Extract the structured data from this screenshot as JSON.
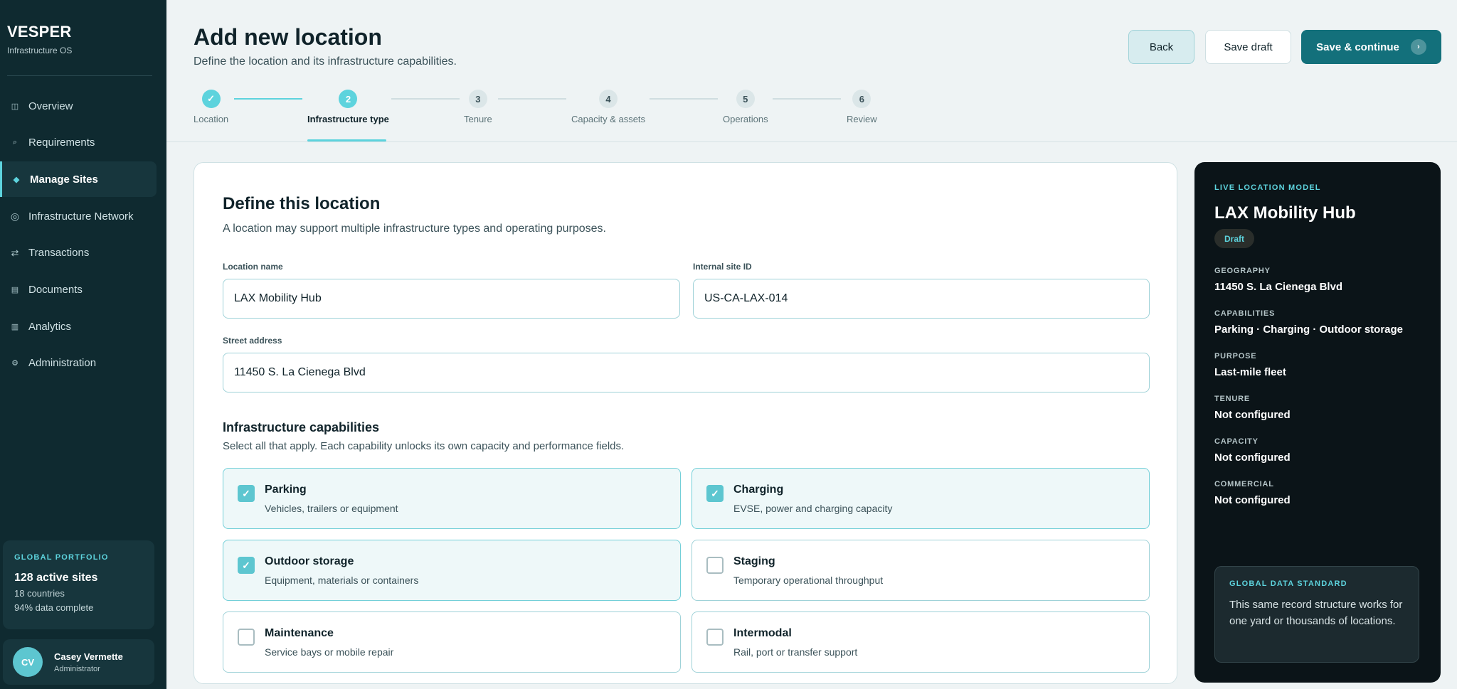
{
  "brand": {
    "name": "VESPER",
    "tagline": "Infrastructure OS"
  },
  "sidebar": {
    "items": [
      {
        "label": "Overview",
        "icon": "grid-icon"
      },
      {
        "label": "Requirements",
        "icon": "search-icon"
      },
      {
        "label": "Manage Sites",
        "icon": "diamond-icon",
        "active": true
      },
      {
        "label": "Infrastructure Network",
        "icon": "ring-icon"
      },
      {
        "label": "Transactions",
        "icon": "arrows-icon"
      },
      {
        "label": "Documents",
        "icon": "document-icon"
      },
      {
        "label": "Analytics",
        "icon": "bar-icon"
      },
      {
        "label": "Administration",
        "icon": "gear-icon"
      }
    ],
    "portfolio": {
      "eyebrow": "GLOBAL PORTFOLIO",
      "headline": "128 active sites",
      "countries": "18 countries",
      "completeness": "94% data complete"
    },
    "user": {
      "initials": "CV",
      "name": "Casey Vermette",
      "role": "Administrator"
    }
  },
  "header": {
    "title": "Add new location",
    "subtitle": "Define the location and its infrastructure capabilities.",
    "back_label": "Back",
    "draft_label": "Save draft",
    "save_label": "Save & continue"
  },
  "stepper": {
    "steps": [
      {
        "number": "1",
        "label": "Location",
        "state": "done"
      },
      {
        "number": "2",
        "label": "Infrastructure type",
        "state": "current"
      },
      {
        "number": "3",
        "label": "Tenure",
        "state": "todo"
      },
      {
        "number": "4",
        "label": "Capacity & assets",
        "state": "todo"
      },
      {
        "number": "5",
        "label": "Operations",
        "state": "todo"
      },
      {
        "number": "6",
        "label": "Review",
        "state": "todo"
      }
    ]
  },
  "form": {
    "title": "Define this location",
    "subtitle": "A location may support multiple infrastructure types and operating purposes.",
    "location_name_label": "Location name",
    "location_name_value": "LAX Mobility Hub",
    "site_id_label": "Internal site ID",
    "site_id_value": "US-CA-LAX-014",
    "street_label": "Street address",
    "street_value": "11450 S. La Cienega Blvd",
    "capabilities_title": "Infrastructure capabilities",
    "capabilities_subtitle": "Select all that apply. Each capability unlocks its own capacity and performance fields.",
    "capabilities": [
      {
        "name": "Parking",
        "desc": "Vehicles, trailers or equipment",
        "checked": true
      },
      {
        "name": "Charging",
        "desc": "EVSE, power and charging capacity",
        "checked": true
      },
      {
        "name": "Outdoor storage",
        "desc": "Equipment, materials or containers",
        "checked": true
      },
      {
        "name": "Staging",
        "desc": "Temporary operational throughput",
        "checked": false
      },
      {
        "name": "Maintenance",
        "desc": "Service bays or mobile repair",
        "checked": false
      },
      {
        "name": "Intermodal",
        "desc": "Rail, port or transfer support",
        "checked": false
      }
    ]
  },
  "panel": {
    "eyebrow": "LIVE LOCATION MODEL",
    "name": "LAX Mobility Hub",
    "status": "Draft",
    "meta": [
      {
        "key": "GEOGRAPHY",
        "value": "11450 S. La Cienega Blvd"
      },
      {
        "key": "CAPABILITIES",
        "value": "Parking · Charging · Outdoor storage"
      },
      {
        "key": "PURPOSE",
        "value": "Last-mile fleet"
      },
      {
        "key": "TENURE",
        "value": "Not configured"
      },
      {
        "key": "CAPACITY",
        "value": "Not configured"
      },
      {
        "key": "COMMERCIAL",
        "value": "Not configured"
      }
    ],
    "standard": {
      "eyebrow": "GLOBAL DATA STANDARD",
      "text": "This same record structure works for one yard or thousands of locations."
    }
  },
  "colors": {
    "accent": "#5dd3dd",
    "primary": "#13707b",
    "sidebar": "#0f2a30",
    "panel": "#0b1418"
  }
}
